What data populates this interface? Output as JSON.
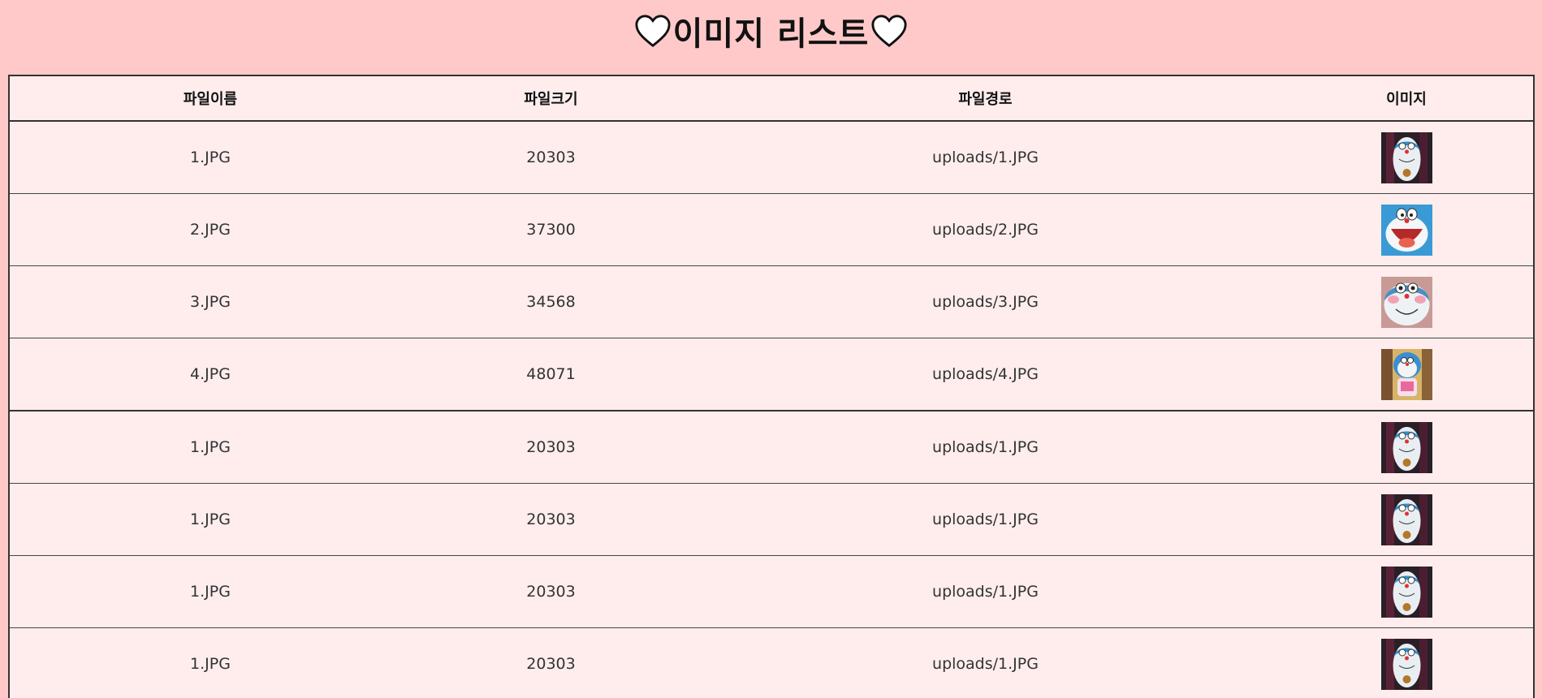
{
  "header": {
    "title": "이미지 리스트"
  },
  "table": {
    "columns": [
      "파일이름",
      "파일크기",
      "파일경로",
      "이미지"
    ],
    "rows": [
      {
        "name": "1.JPG",
        "size": "20303",
        "path": "uploads/1.JPG",
        "thumb": "doraemon-standing-dark"
      },
      {
        "name": "2.JPG",
        "size": "37300",
        "path": "uploads/2.JPG",
        "thumb": "doraemon-laughing"
      },
      {
        "name": "3.JPG",
        "size": "34568",
        "path": "uploads/3.JPG",
        "thumb": "doraemon-blushing"
      },
      {
        "name": "4.JPG",
        "size": "48071",
        "path": "uploads/4.JPG",
        "thumb": "doraemon-holding-cup"
      },
      {
        "name": "1.JPG",
        "size": "20303",
        "path": "uploads/1.JPG",
        "thumb": "doraemon-standing-dark"
      },
      {
        "name": "1.JPG",
        "size": "20303",
        "path": "uploads/1.JPG",
        "thumb": "doraemon-standing-dark"
      },
      {
        "name": "1.JPG",
        "size": "20303",
        "path": "uploads/1.JPG",
        "thumb": "doraemon-standing-dark"
      },
      {
        "name": "1.JPG",
        "size": "20303",
        "path": "uploads/1.JPG",
        "thumb": "doraemon-standing-dark"
      }
    ]
  },
  "colors": {
    "page_background": "#ffc9c9",
    "table_background": "#ffeded",
    "border": "#333333"
  }
}
